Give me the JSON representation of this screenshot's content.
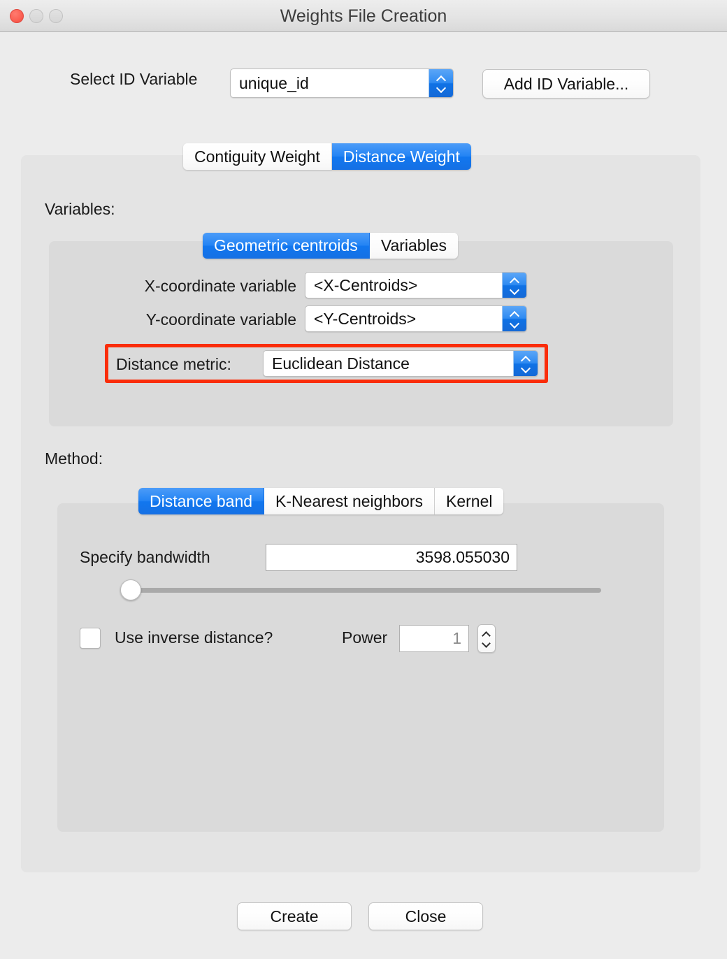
{
  "window": {
    "title": "Weights File Creation",
    "traffic_lights": [
      "close",
      "minimize",
      "maximize"
    ]
  },
  "id_variable": {
    "label": "Select ID Variable",
    "selected": "unique_id",
    "add_button": "Add ID Variable..."
  },
  "weight_tabs": [
    {
      "label": "Contiguity Weight",
      "active": false
    },
    {
      "label": "Distance Weight",
      "active": true
    }
  ],
  "variables": {
    "section_label": "Variables:",
    "tabs": [
      {
        "label": "Geometric centroids",
        "active": true
      },
      {
        "label": "Variables",
        "active": false
      }
    ],
    "x_label": "X-coordinate variable",
    "x_value": "<X-Centroids>",
    "y_label": "Y-coordinate variable",
    "y_value": "<Y-Centroids>",
    "metric_label": "Distance metric:",
    "metric_value": "Euclidean Distance",
    "highlight_color": "#fa2d0a"
  },
  "method": {
    "section_label": "Method:",
    "tabs": [
      {
        "label": "Distance band",
        "active": true
      },
      {
        "label": "K-Nearest neighbors",
        "active": false
      },
      {
        "label": "Kernel",
        "active": false
      }
    ],
    "bandwidth_label": "Specify bandwidth",
    "bandwidth_value": "3598.055030",
    "slider_position_percent": 0,
    "inverse_label": "Use inverse distance?",
    "inverse_checked": false,
    "power_label": "Power",
    "power_value": "1"
  },
  "footer": {
    "create_label": "Create",
    "close_label": "Close"
  },
  "colors": {
    "accent_blue": "#1277ef",
    "window_bg": "#ececec",
    "panel_bg": "#e4e4e4",
    "inner_panel_bg": "#dadada",
    "highlight_red": "#fa2d0a",
    "close_light": "#fb5f52"
  }
}
